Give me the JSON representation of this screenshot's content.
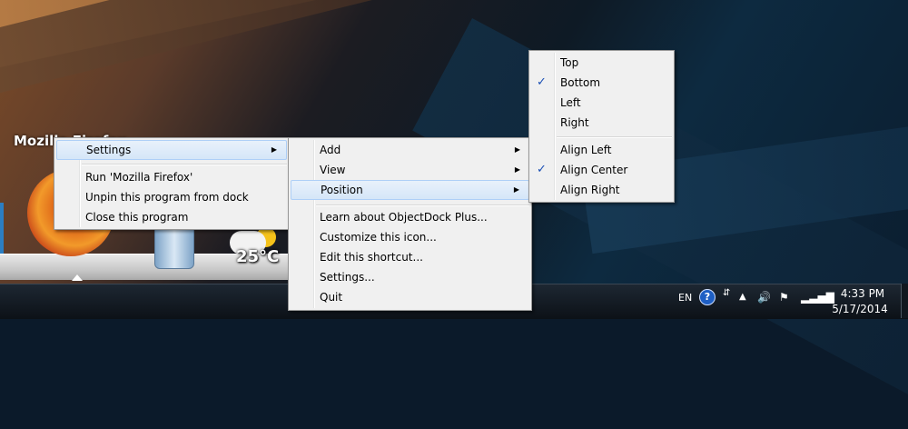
{
  "desktop": {
    "app_title": "Mozilla Firefox",
    "weather_temp": "25°C"
  },
  "context_menu": {
    "settings_label": "Settings",
    "run_label": "Run 'Mozilla Firefox'",
    "unpin_label": "Unpin this program from dock",
    "close_label": "Close this program"
  },
  "settings_submenu": {
    "add_label": "Add",
    "view_label": "View",
    "position_label": "Position",
    "learn_label": "Learn about ObjectDock Plus...",
    "customize_label": "Customize this icon...",
    "edit_label": "Edit this shortcut...",
    "settings_label": "Settings...",
    "quit_label": "Quit"
  },
  "position_submenu": {
    "top_label": "Top",
    "bottom_label": "Bottom",
    "left_label": "Left",
    "right_label": "Right",
    "align_left_label": "Align Left",
    "align_center_label": "Align Center",
    "align_right_label": "Align Right",
    "checked": [
      "Bottom",
      "Align Center"
    ],
    "check_glyph": "✓"
  },
  "taskbar": {
    "language": "EN",
    "help_glyph": "?",
    "time": "4:33 PM",
    "date": "5/17/2014"
  },
  "icons": {
    "submenu_arrow": "▶",
    "tray_arrow": "▲",
    "volume": "🔊",
    "flag": "⚑",
    "network": "▂▃▅▇"
  },
  "colors": {
    "menu_bg": "#f0f0f0",
    "highlight": "#d5e6f8",
    "check": "#1a4fb5",
    "taskbar": "#0c1117"
  }
}
